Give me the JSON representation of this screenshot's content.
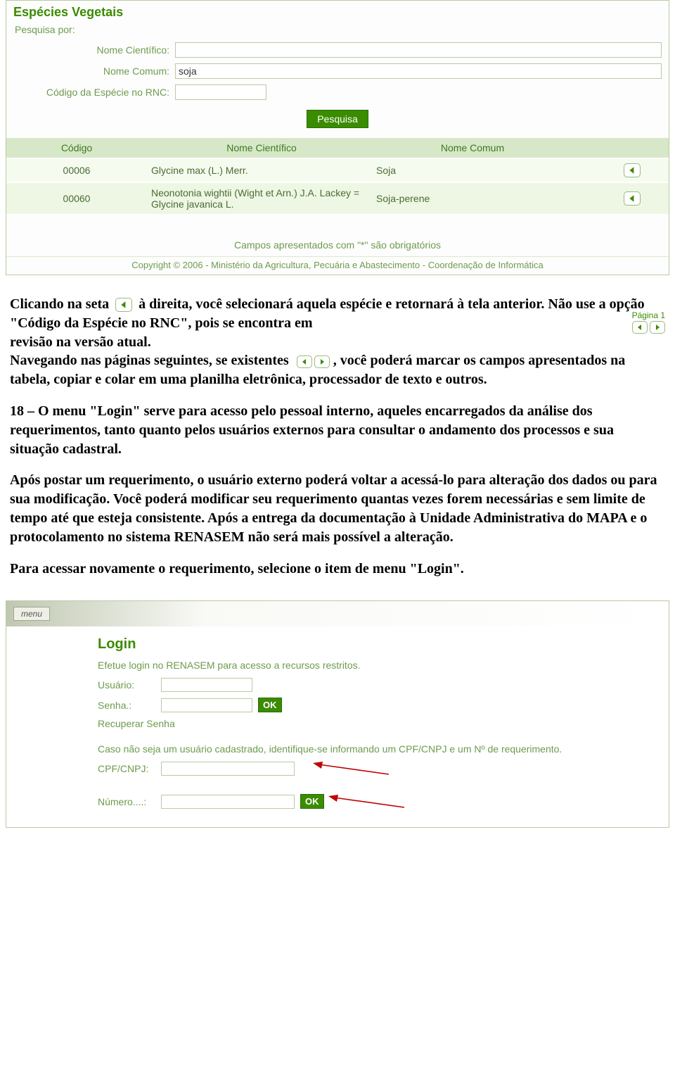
{
  "searchPanel": {
    "title": "Espécies Vegetais",
    "searchBy": "Pesquisa por:",
    "labels": {
      "scientific": "Nome Científico:",
      "common": "Nome Comum:",
      "code": "Código da Espécie no RNC:"
    },
    "values": {
      "scientific": "",
      "common": "soja",
      "code": ""
    },
    "button": "Pesquisa"
  },
  "resultsTable": {
    "headers": {
      "code": "Código",
      "scientific": "Nome Científico",
      "common": "Nome Comum"
    },
    "rows": [
      {
        "code": "00006",
        "scientific": "Glycine max (L.) Merr.",
        "common": "Soja"
      },
      {
        "code": "00060",
        "scientific": "Neonotonia wightii (Wight et Arn.) J.A. Lackey = Glycine javanica L.",
        "common": "Soja-perene"
      }
    ]
  },
  "mandatoryNote": "Campos apresentados com \"*\" são obrigatórios",
  "copyright": "Copyright © 2006 - Ministério da Agricultura, Pecuária e Abastecimento - Coordenação de Informática",
  "body": {
    "p1a": "Clicando na seta",
    "p1b": "à direita, você selecionará aquela espécie e retornará à tela anterior. Não use a opção \"Código da Espécie no RNC\", pois se encontra em",
    "p1c": "revisão na versão atual.",
    "pagerLabel": "Página 1",
    "p2a": "Navegando nas páginas seguintes, se existentes",
    "p2b": ", você poderá marcar os campos apresentados na tabela, copiar e colar em uma planilha eletrônica, processador de texto e outros.",
    "p3": "18 – O menu \"Login\" serve para acesso pelo pessoal interno, aqueles encarregados da análise dos requerimentos, tanto quanto pelos usuários externos para consultar o andamento dos processos e sua situação cadastral.",
    "p4": "Após postar um requerimento, o usuário externo poderá voltar a acessá-lo para alteração dos dados ou para sua modificação. Você poderá modificar seu requerimento quantas vezes forem necessárias e sem limite de tempo até que esteja consistente. Após a entrega da documentação à Unidade Administrativa do MAPA e o protocolamento no sistema RENASEM não será mais possível a alteração.",
    "p5": "Para acessar novamente o requerimento, selecione o item de menu \"Login\"."
  },
  "loginPanel": {
    "menu": "menu",
    "title": "Login",
    "sub1": "Efetue login no RENASEM para acesso a recursos restritos.",
    "userLabel": "Usuário:",
    "passLabel": "Senha.:",
    "ok": "OK",
    "recover": "Recuperar Senha",
    "sub2": "Caso não seja um usuário cadastrado, identifique-se informando um CPF/CNPJ e um Nº de requerimento.",
    "cpfLabel": "CPF/CNPJ:",
    "numLabel": "Número....:"
  }
}
